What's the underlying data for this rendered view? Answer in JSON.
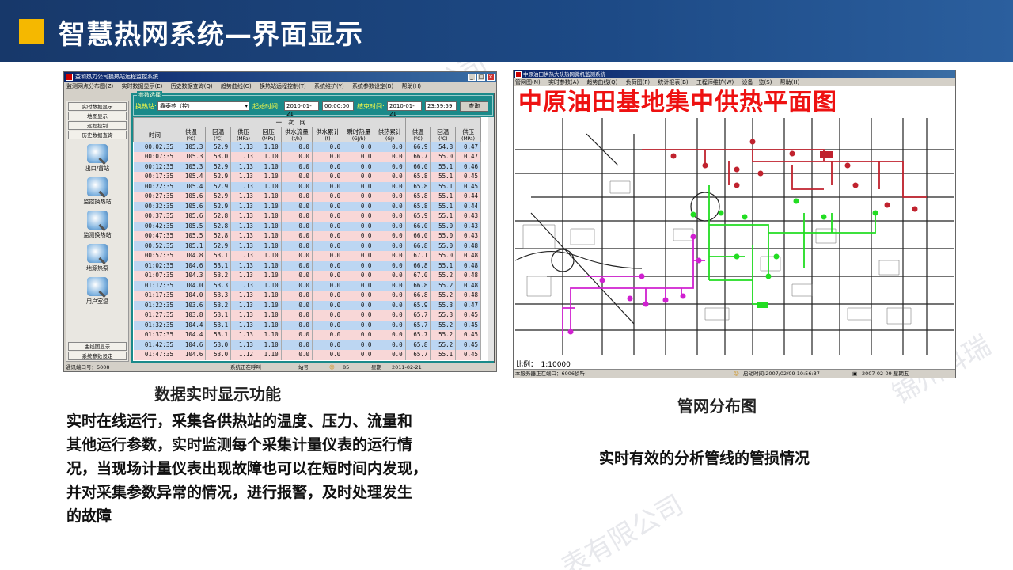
{
  "header": {
    "title": "智慧热网系统—界面显示"
  },
  "left_window": {
    "title": "益和热力公司换热站远程监控系统",
    "menu": [
      "监测网点分布图(Z)",
      "实时数据显示(E)",
      "历史数据查询(Q)",
      "趋势曲线(G)",
      "换热站远程控制(T)",
      "系统维护(Y)",
      "系统参数设定(B)",
      "帮助(H)"
    ],
    "sidebar_top": [
      "实时数据显示",
      "地图显示",
      "远程控制",
      "历史数据查询"
    ],
    "nav": [
      "出口/首站",
      "监控换热站",
      "监测换热站",
      "地源热泵",
      "用户室温"
    ],
    "sidebar_bottom": [
      "曲线图显示",
      "系统参数设定"
    ],
    "param_group": "参数选择",
    "station_label": "换热站:",
    "station_value": "鑫泰苑（控）",
    "start_label": "起始时间:",
    "start_date": "2010-01-21",
    "start_time": "00:00:00",
    "end_label": "结束时间:",
    "end_date": "2010-01-21",
    "end_time": "23:59:59",
    "query_button": "查询",
    "group_header": "一　次　网",
    "columns": [
      {
        "name": "时间",
        "unit": ""
      },
      {
        "name": "供温",
        "unit": "(℃)"
      },
      {
        "name": "回温",
        "unit": "(℃)"
      },
      {
        "name": "供压",
        "unit": "(MPa)"
      },
      {
        "name": "回压",
        "unit": "(MPa)"
      },
      {
        "name": "供水流量",
        "unit": "(t/h)"
      },
      {
        "name": "供水累计",
        "unit": "(t)"
      },
      {
        "name": "瞬时热量",
        "unit": "(GJ/h)"
      },
      {
        "name": "供热累计",
        "unit": "(GJ)"
      },
      {
        "name": "供温",
        "unit": "(℃)"
      },
      {
        "name": "回温",
        "unit": "(℃)"
      },
      {
        "name": "供压",
        "unit": "(MPa)"
      }
    ],
    "rows": [
      [
        "00:02:35",
        "105.3",
        "52.9",
        "1.13",
        "1.10",
        "0.0",
        "0.0",
        "0.0",
        "0.0",
        "66.9",
        "54.8",
        "0.47"
      ],
      [
        "00:07:35",
        "105.3",
        "53.0",
        "1.13",
        "1.10",
        "0.0",
        "0.0",
        "0.0",
        "0.0",
        "66.7",
        "55.0",
        "0.47"
      ],
      [
        "00:12:35",
        "105.3",
        "52.9",
        "1.13",
        "1.10",
        "0.0",
        "0.0",
        "0.0",
        "0.0",
        "66.0",
        "55.1",
        "0.46"
      ],
      [
        "00:17:35",
        "105.4",
        "52.9",
        "1.13",
        "1.10",
        "0.0",
        "0.0",
        "0.0",
        "0.0",
        "65.8",
        "55.1",
        "0.45"
      ],
      [
        "00:22:35",
        "105.4",
        "52.9",
        "1.13",
        "1.10",
        "0.0",
        "0.0",
        "0.0",
        "0.0",
        "65.8",
        "55.1",
        "0.45"
      ],
      [
        "00:27:35",
        "105.6",
        "52.9",
        "1.13",
        "1.10",
        "0.0",
        "0.0",
        "0.0",
        "0.0",
        "65.8",
        "55.1",
        "0.44"
      ],
      [
        "00:32:35",
        "105.6",
        "52.9",
        "1.13",
        "1.10",
        "0.0",
        "0.0",
        "0.0",
        "0.0",
        "65.8",
        "55.1",
        "0.44"
      ],
      [
        "00:37:35",
        "105.6",
        "52.8",
        "1.13",
        "1.10",
        "0.0",
        "0.0",
        "0.0",
        "0.0",
        "65.9",
        "55.1",
        "0.43"
      ],
      [
        "00:42:35",
        "105.5",
        "52.8",
        "1.13",
        "1.10",
        "0.0",
        "0.0",
        "0.0",
        "0.0",
        "66.0",
        "55.0",
        "0.43"
      ],
      [
        "00:47:35",
        "105.5",
        "52.8",
        "1.13",
        "1.10",
        "0.0",
        "0.0",
        "0.0",
        "0.0",
        "66.0",
        "55.0",
        "0.43"
      ],
      [
        "00:52:35",
        "105.1",
        "52.9",
        "1.13",
        "1.10",
        "0.0",
        "0.0",
        "0.0",
        "0.0",
        "66.8",
        "55.0",
        "0.48"
      ],
      [
        "00:57:35",
        "104.8",
        "53.1",
        "1.13",
        "1.10",
        "0.0",
        "0.0",
        "0.0",
        "0.0",
        "67.1",
        "55.0",
        "0.48"
      ],
      [
        "01:02:35",
        "104.6",
        "53.1",
        "1.13",
        "1.10",
        "0.0",
        "0.0",
        "0.0",
        "0.0",
        "66.8",
        "55.1",
        "0.48"
      ],
      [
        "01:07:35",
        "104.3",
        "53.2",
        "1.13",
        "1.10",
        "0.0",
        "0.0",
        "0.0",
        "0.0",
        "67.0",
        "55.2",
        "0.48"
      ],
      [
        "01:12:35",
        "104.0",
        "53.3",
        "1.13",
        "1.10",
        "0.0",
        "0.0",
        "0.0",
        "0.0",
        "66.8",
        "55.2",
        "0.48"
      ],
      [
        "01:17:35",
        "104.0",
        "53.3",
        "1.13",
        "1.10",
        "0.0",
        "0.0",
        "0.0",
        "0.0",
        "66.8",
        "55.2",
        "0.48"
      ],
      [
        "01:22:35",
        "103.6",
        "53.2",
        "1.13",
        "1.10",
        "0.0",
        "0.0",
        "0.0",
        "0.0",
        "65.9",
        "55.3",
        "0.47"
      ],
      [
        "01:27:35",
        "103.8",
        "53.1",
        "1.13",
        "1.10",
        "0.0",
        "0.0",
        "0.0",
        "0.0",
        "65.7",
        "55.3",
        "0.45"
      ],
      [
        "01:32:35",
        "104.4",
        "53.1",
        "1.13",
        "1.10",
        "0.0",
        "0.0",
        "0.0",
        "0.0",
        "65.7",
        "55.2",
        "0.45"
      ],
      [
        "01:37:35",
        "104.4",
        "53.1",
        "1.13",
        "1.10",
        "0.0",
        "0.0",
        "0.0",
        "0.0",
        "65.7",
        "55.2",
        "0.45"
      ],
      [
        "01:42:35",
        "104.6",
        "53.0",
        "1.13",
        "1.10",
        "0.0",
        "0.0",
        "0.0",
        "0.0",
        "65.8",
        "55.2",
        "0.45"
      ],
      [
        "01:47:35",
        "104.6",
        "53.0",
        "1.12",
        "1.10",
        "0.0",
        "0.0",
        "0.0",
        "0.0",
        "65.7",
        "55.1",
        "0.45"
      ]
    ],
    "status": {
      "port": "通讯端口号：5008",
      "state": "系统正在呼叫",
      "station": "站号",
      "count": "85",
      "date": "星期一　2011-02-21"
    }
  },
  "right_window": {
    "title": "中原油田供热大队热网微机监测系统",
    "menu": [
      "管网图(N)",
      "实时参数(A)",
      "趋势曲线(Q)",
      "负荷图(F)",
      "统计报表(B)",
      "工程师维护(W)",
      "设备一览(S)",
      "帮助(H)"
    ],
    "map_title": "中原油田基地集中供热平面图",
    "scale": "比例：　1:10000",
    "status": {
      "server": "本服务器正在端口：6006侦听!",
      "start": "启动时间:2007/02/09 10:56:37",
      "date": "2007-02-09 星期五"
    }
  },
  "captions": {
    "left": "数据实时显示功能",
    "right": "管网分布图"
  },
  "paragraphs": {
    "left": [
      "实时在线运行，采集各供热站的温度、压力、流量和",
      "其他运行参数，实时监测每个采集计量仪表的运行情",
      "况，当现场计量仪表出现故障也可以在短时间内发现，",
      "并对采集参数异常的情况，进行报警，及时处理发生",
      "的故障"
    ],
    "right": "实时有效的分析管线的管损情况"
  },
  "colors": {
    "banner": "#1d4a86",
    "accent": "#f5b800",
    "map_title": "#e11111"
  }
}
